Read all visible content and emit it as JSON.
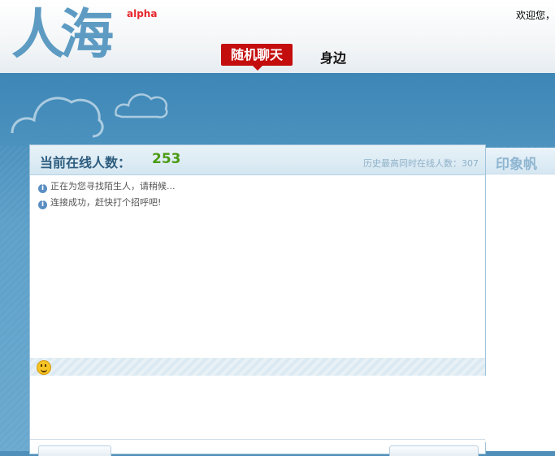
{
  "header": {
    "logo_text": "人海",
    "badge": "alpha",
    "welcome": "欢迎您，"
  },
  "nav": {
    "items": [
      {
        "label": "随机聊天",
        "active": true
      },
      {
        "label": "身边",
        "active": false
      }
    ],
    "active_color": "#c40d0d"
  },
  "chat": {
    "online_label": "当前在线人数：",
    "online_count": "253",
    "history_label": "历史最高同时在线人数：307",
    "messages": [
      {
        "icon": "info-icon",
        "text": "正在为您寻找陌生人，请稍候..."
      },
      {
        "icon": "info-icon",
        "text": "连接成功，赶快打个招呼吧!"
      }
    ],
    "emoji_icon": "smiley-icon"
  },
  "side": {
    "title": "印象帆"
  }
}
